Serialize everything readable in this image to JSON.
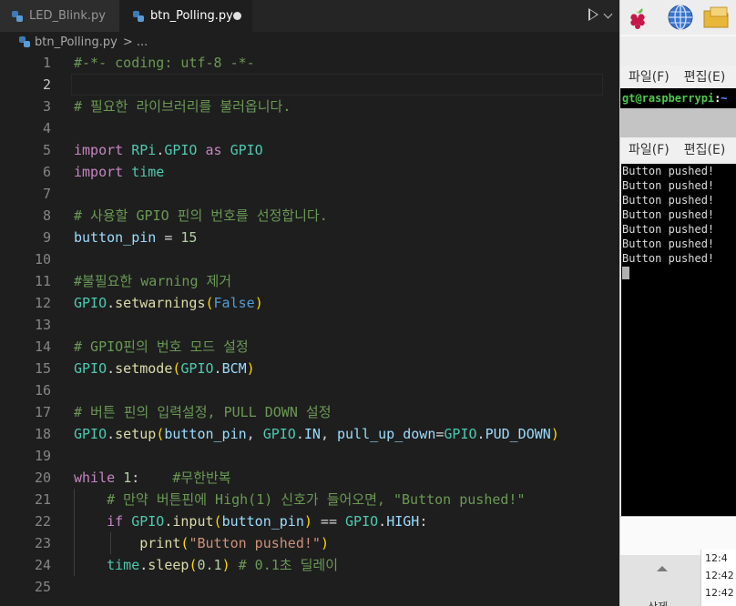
{
  "tabs": [
    {
      "label": "LED_Blink.py",
      "active": false
    },
    {
      "label": "btn_Polling.py",
      "active": true,
      "modified": true
    }
  ],
  "breadcrumb": {
    "file": "btn_Polling.py",
    "trail": "..."
  },
  "code": {
    "line_numbers": [
      "1",
      "2",
      "3",
      "4",
      "5",
      "6",
      "7",
      "8",
      "9",
      "10",
      "11",
      "12",
      "13",
      "14",
      "15",
      "16",
      "17",
      "18",
      "19",
      "20",
      "21",
      "22",
      "23",
      "24",
      "25"
    ],
    "active_line": "2",
    "tokens": {
      "l1": "#-*- coding: utf-8 -*-",
      "l3": "# 필요한 라이브러리를 불러옵니다.",
      "import": "import",
      "as": "as",
      "rpi": "RPi",
      "gpio": "GPIO",
      "time": "time",
      "l8": "# 사용할 GPIO 핀의 번호를 선정합니다.",
      "button_pin": "button_pin",
      "eq": " = ",
      "n15": "15",
      "l11": "#불필요한 warning 제거",
      "setwarnings": "setwarnings",
      "false": "False",
      "l14": "# GPIO핀의 번호 모드 설정",
      "setmode": "setmode",
      "bcm": "BCM",
      "l17": "# 버튼 핀의 입력설정, PULL DOWN 설정",
      "setup": "setup",
      "in": "IN",
      "pull_up_down": "pull_up_down",
      "pud_down": "PUD_DOWN",
      "while": "while",
      "n1": "1",
      "l20c": "#무한반복",
      "l21": "# 만약 버튼핀에 High(1) 신호가 들어오면, \"Button pushed!\"",
      "if": "if",
      "input": "input",
      "eqeq": " == ",
      "high": "HIGH",
      "print": "print",
      "msg": "\"Button pushed!\"",
      "sleep": "sleep",
      "n01": "0.1",
      "l24c": "# 0.1초 딜레이"
    }
  },
  "rpi": {
    "menu_file": "파일(F)",
    "menu_edit": "편집(E)",
    "prompt_user": "gt@raspberrypi",
    "prompt_colon": ":",
    "prompt_tilde": "~",
    "output_lines": [
      "Button pushed!",
      "Button pushed!",
      "Button pushed!",
      "Button pushed!",
      "Button pushed!",
      "Button pushed!",
      "Button pushed!"
    ],
    "bottom_label": "삭제",
    "timestamps": [
      "12:4",
      "12:42",
      "12:42"
    ]
  },
  "icons": {
    "raspberry": "raspberry-pi-icon",
    "globe": "globe-icon",
    "folder": "folder-icon"
  }
}
